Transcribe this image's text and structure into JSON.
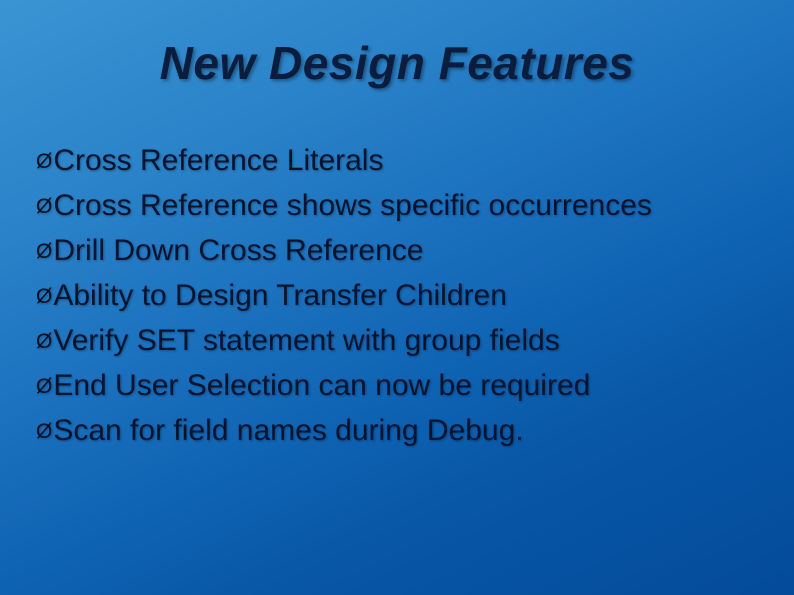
{
  "title": "New Design Features",
  "bullet_marker": "Ø",
  "bullets": [
    "Cross Reference Literals",
    "Cross Reference shows specific occurrences",
    "Drill Down Cross Reference",
    "Ability to Design Transfer Children",
    "Verify SET statement with group fields",
    "End User Selection can now be required",
    "Scan for field names during Debug."
  ]
}
